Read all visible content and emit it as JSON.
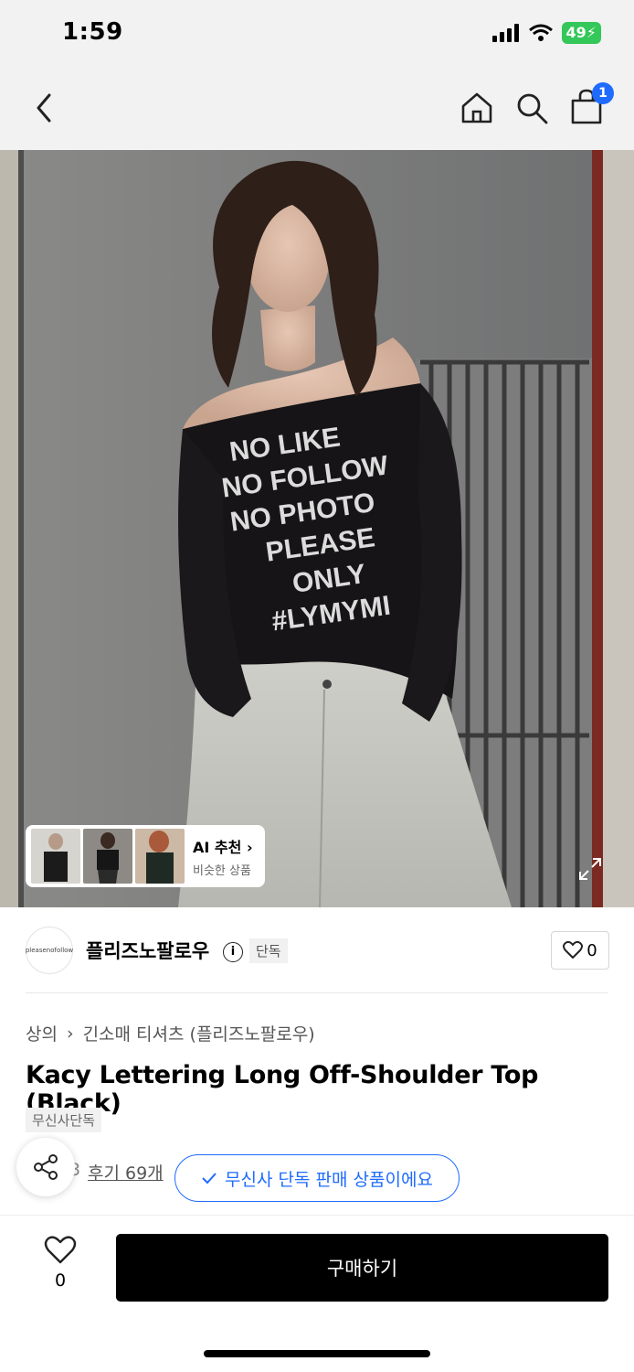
{
  "status_bar": {
    "time": "1:59",
    "battery": "49"
  },
  "nav": {
    "cart_count": "1"
  },
  "hero": {
    "shirt_text": [
      "NO LIKE",
      "NO FOLLOW",
      "NO PHOTO",
      "PLEASE",
      "ONLY",
      "#LYMYMI"
    ]
  },
  "ai_card": {
    "title": "AI 추천",
    "subtitle": "비슷한 상품"
  },
  "brand": {
    "logo_text": "pleasenofollow",
    "name": "플리즈노팔로우",
    "badge": "단독",
    "like_count": "0"
  },
  "breadcrumb": {
    "category": "상의",
    "subcategory": "긴소매 티셔츠 (플리즈노팔로우)"
  },
  "product": {
    "title": "Kacy Lettering Long Off-Shoulder Top (Black)",
    "tag": "무신사단독"
  },
  "reviews": {
    "rating_fragment": "3",
    "label": "후기 69개"
  },
  "exclusive_notice": "무신사 단독 판매 상품이에요",
  "bottom_bar": {
    "wish_count": "0",
    "buy_label": "구매하기"
  }
}
